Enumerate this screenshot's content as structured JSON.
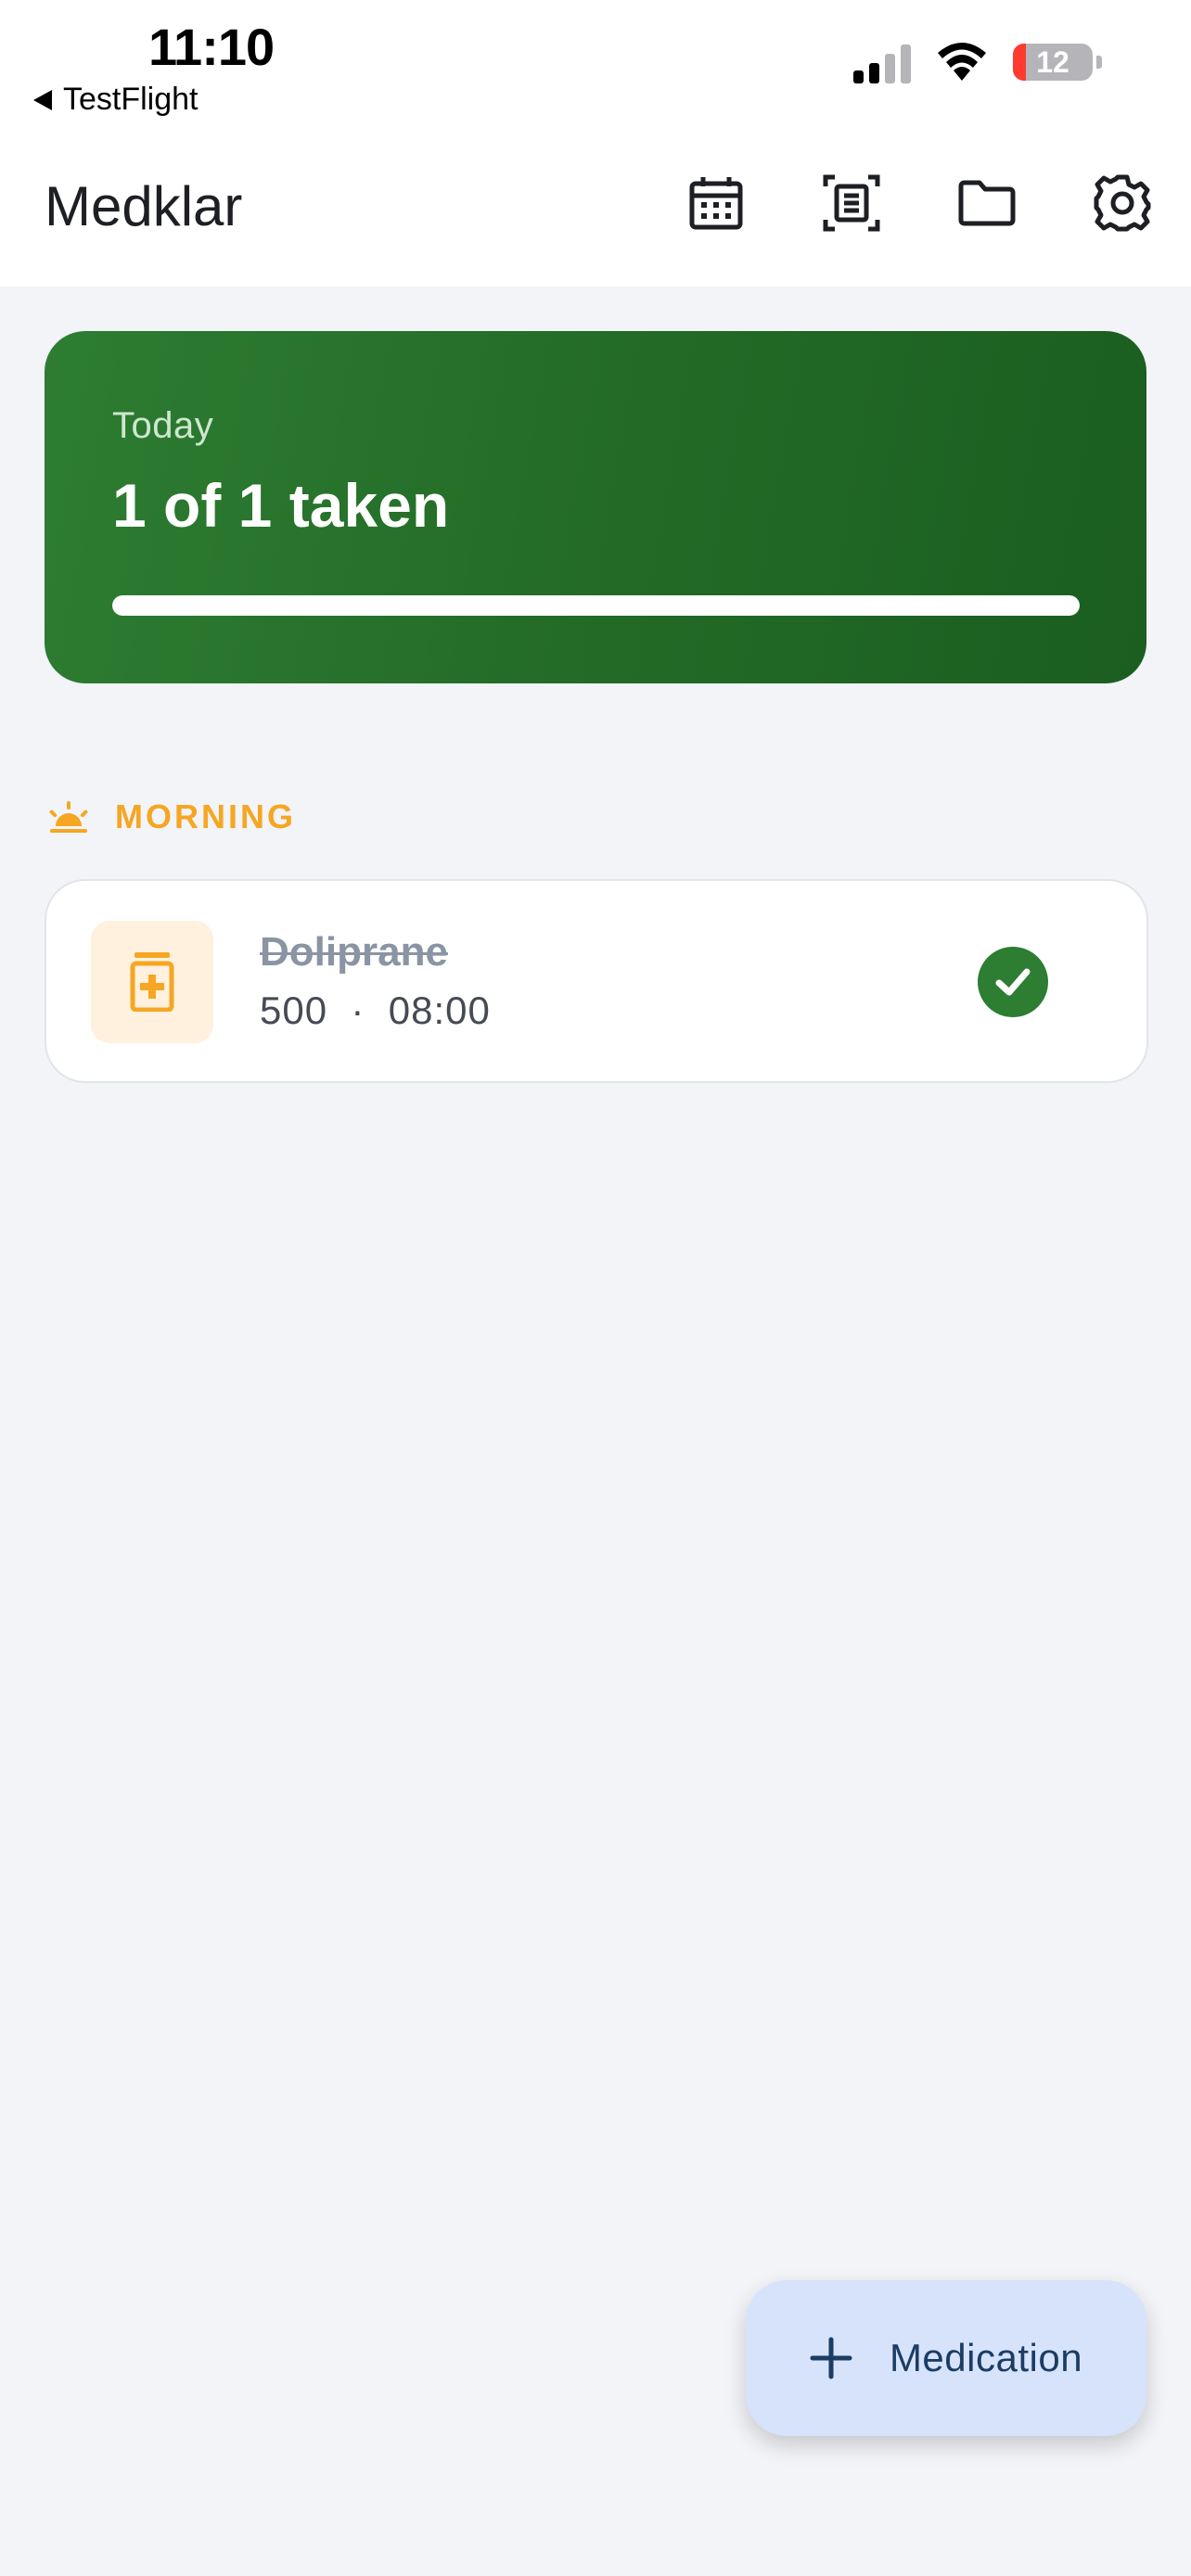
{
  "status_bar": {
    "time": "11:10",
    "back_app": "TestFlight",
    "battery_percent": "12"
  },
  "app_bar": {
    "title": "Medklar",
    "actions": [
      "calendar-icon",
      "document-scan-icon",
      "folder-icon",
      "gear-icon"
    ]
  },
  "summary": {
    "label": "Today",
    "value": "1 of 1 taken",
    "progress": 1.0,
    "colors": {
      "start": "#2d7d32",
      "end": "#1b5e20"
    }
  },
  "sections": [
    {
      "title": "MORNING",
      "icon": "sunrise-icon",
      "color": "#f5a623",
      "items": [
        {
          "name": "Doliprane",
          "detail": "500  ·  08:00",
          "taken": true,
          "icon": "medicine-bottle-icon"
        }
      ]
    }
  ],
  "fab": {
    "label": "Medication",
    "icon": "plus-icon"
  },
  "colors": {
    "accent_green": "#2d7d32",
    "morning_orange": "#f5a623",
    "fab_bg": "#d6e3fb"
  }
}
